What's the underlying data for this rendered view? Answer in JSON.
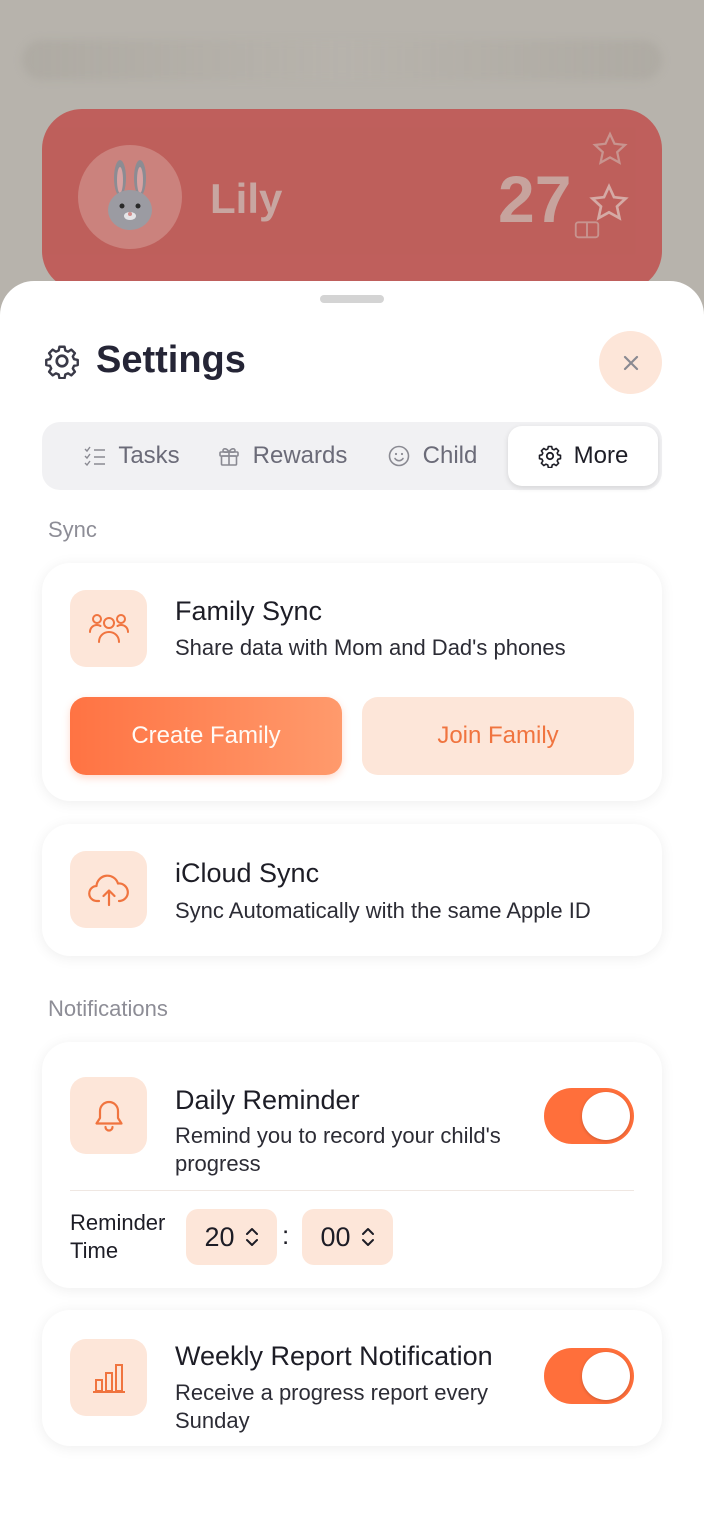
{
  "background": {
    "child_name": "Lily",
    "child_points": "27"
  },
  "header": {
    "title": "Settings"
  },
  "tabs": [
    {
      "label": "Tasks",
      "icon": "checklist-icon"
    },
    {
      "label": "Rewards",
      "icon": "gift-icon"
    },
    {
      "label": "Child",
      "icon": "smile-icon"
    },
    {
      "label": "More",
      "icon": "gear-icon",
      "active": true
    }
  ],
  "sync": {
    "section_label": "Sync",
    "family": {
      "title": "Family Sync",
      "subtitle": "Share data with Mom and Dad's phones",
      "create_label": "Create Family",
      "join_label": "Join Family"
    },
    "icloud": {
      "title": "iCloud Sync",
      "subtitle": "Sync Automatically with the same Apple ID"
    }
  },
  "notifications": {
    "section_label": "Notifications",
    "daily": {
      "title": "Daily Reminder",
      "subtitle_line1": "Remind you to record your child's",
      "subtitle_line2": "progress",
      "enabled": true,
      "time_label_line1": "Reminder",
      "time_label_line2": "Time",
      "hour": "20",
      "separator": ":",
      "minute": "00"
    },
    "weekly": {
      "title": "Weekly Report Notification",
      "subtitle_line1": "Receive a progress report every",
      "subtitle_line2": "Sunday",
      "enabled": true
    }
  },
  "colors": {
    "accent": "#ff6f3b",
    "accent_soft": "#fde6d9",
    "child_card": "#bf5b57"
  }
}
